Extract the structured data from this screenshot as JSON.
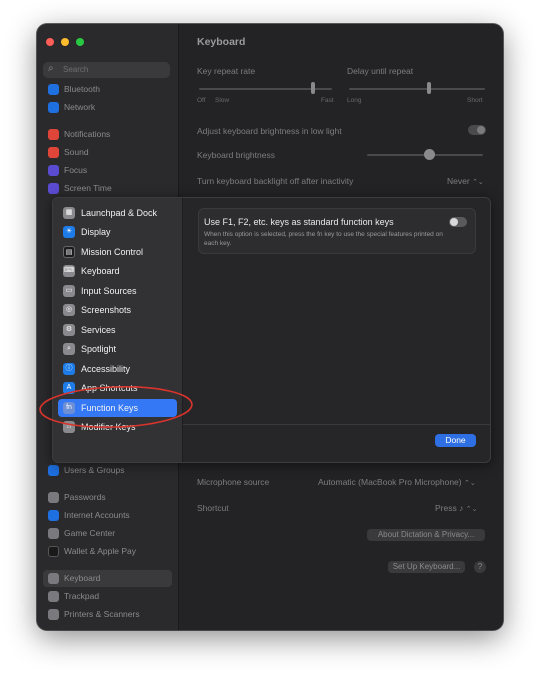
{
  "window": {
    "traffic_colors": [
      "#ff5f57",
      "#febc2e",
      "#28c840"
    ]
  },
  "search": {
    "placeholder": "Search",
    "icon": "magnifier-icon"
  },
  "sidebar": {
    "items": [
      {
        "label": "Bluetooth",
        "icon": "bluetooth-icon",
        "color": "#1e6fe0"
      },
      {
        "label": "Network",
        "icon": "globe-icon",
        "color": "#1e6fe0"
      },
      {
        "label": "Notifications",
        "icon": "bell-icon",
        "color": "#e0453a"
      },
      {
        "label": "Sound",
        "icon": "speaker-icon",
        "color": "#e0453a"
      },
      {
        "label": "Focus",
        "icon": "moon-icon",
        "color": "#5b4bd1"
      },
      {
        "label": "Screen Time",
        "icon": "hourglass-icon",
        "color": "#5b4bd1"
      },
      {
        "label": "Users & Groups",
        "icon": "users-icon",
        "color": "#1e6fe0"
      },
      {
        "label": "Passwords",
        "icon": "key-icon",
        "color": "#7a7a7e"
      },
      {
        "label": "Internet Accounts",
        "icon": "at-icon",
        "color": "#1e6fe0"
      },
      {
        "label": "Game Center",
        "icon": "game-center-icon",
        "color": "#7a7a7e"
      },
      {
        "label": "Wallet & Apple Pay",
        "icon": "wallet-icon",
        "color": "#2a2a2a"
      },
      {
        "label": "Keyboard",
        "icon": "keyboard-icon",
        "color": "#7a7a7e"
      },
      {
        "label": "Trackpad",
        "icon": "trackpad-icon",
        "color": "#7a7a7e"
      },
      {
        "label": "Printers & Scanners",
        "icon": "printer-icon",
        "color": "#7a7a7e"
      }
    ]
  },
  "main": {
    "title": "Keyboard",
    "key_repeat_rate": {
      "label": "Key repeat rate",
      "min": "Off",
      "min2": "Slow",
      "max": "Fast"
    },
    "delay_until_repeat": {
      "label": "Delay until repeat",
      "min": "Long",
      "max": "Short"
    },
    "adjust_brightness_label": "Adjust keyboard brightness in low light",
    "keyboard_brightness_label": "Keyboard brightness",
    "backlight_off_label": "Turn keyboard backlight off after inactivity",
    "backlight_off_value": "Never",
    "microphone_source_label": "Microphone source",
    "microphone_source_value": "Automatic (MacBook Pro Microphone)",
    "shortcut_label": "Shortcut",
    "shortcut_value": "Press",
    "about_dictation_button": "About Dictation & Privacy...",
    "set_up_keyboard_button": "Set Up Keyboard...",
    "help_glyph": "?",
    "stepper_glyph": "⌃⌄"
  },
  "popup": {
    "items": [
      {
        "label": "Launchpad & Dock",
        "icon": "launchpad-icon",
        "color": "#8a8a8e",
        "glyph": "▦"
      },
      {
        "label": "Display",
        "icon": "display-icon",
        "color": "#1e7ce8",
        "glyph": "☀"
      },
      {
        "label": "Mission Control",
        "icon": "mission-control-icon",
        "color": "#1c1c1e",
        "glyph": "▤"
      },
      {
        "label": "Keyboard",
        "icon": "keyboard-icon",
        "color": "#8a8a8e",
        "glyph": "⌨"
      },
      {
        "label": "Input Sources",
        "icon": "input-sources-icon",
        "color": "#8a8a8e",
        "glyph": "▭"
      },
      {
        "label": "Screenshots",
        "icon": "screenshot-icon",
        "color": "#8a8a8e",
        "glyph": "◎"
      },
      {
        "label": "Services",
        "icon": "gear-icon",
        "color": "#8a8a8e",
        "glyph": "⚙"
      },
      {
        "label": "Spotlight",
        "icon": "search-icon",
        "color": "#8a8a8e",
        "glyph": "⌕"
      },
      {
        "label": "Accessibility",
        "icon": "accessibility-icon",
        "color": "#1e7ce8",
        "glyph": "ⓘ"
      },
      {
        "label": "App Shortcuts",
        "icon": "app-store-icon",
        "color": "#1e7ce8",
        "glyph": "A"
      },
      {
        "label": "Function Keys",
        "icon": "fn-icon",
        "color": "#8a8a8e",
        "glyph": "fn"
      },
      {
        "label": "Modifier Keys",
        "icon": "modifier-keys-icon",
        "color": "#8a8a8e",
        "glyph": "⌂"
      }
    ],
    "selected_index": 10,
    "function_keys": {
      "title": "Use F1, F2, etc. keys as standard function keys",
      "description": "When this option is selected, press the fn key to use the special features printed on each key."
    },
    "done_label": "Done",
    "highlight_color": "#d8342c"
  }
}
